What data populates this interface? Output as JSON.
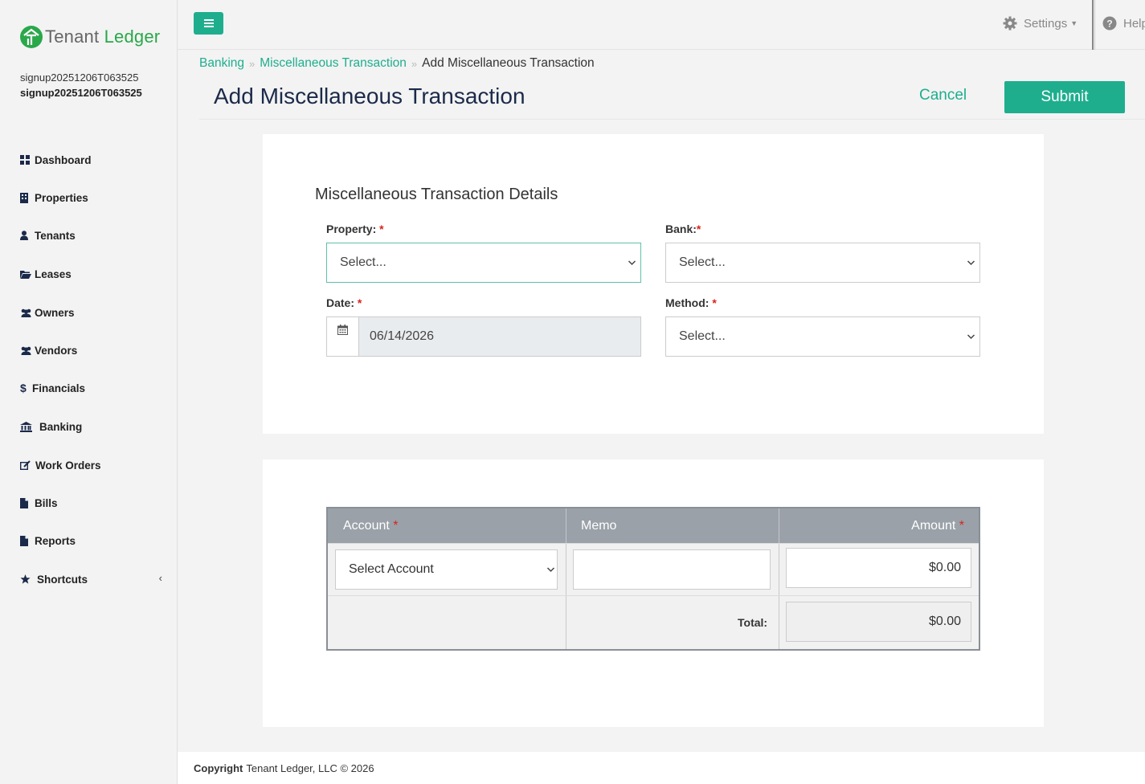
{
  "app": {
    "logo_part1": "Tenant",
    "logo_part2": "Ledger",
    "user_line1": "signup20251206T063525",
    "user_line2": "signup20251206T063525"
  },
  "sidebar": {
    "items": [
      {
        "label": "Dashboard",
        "icon": "dashboard-icon"
      },
      {
        "label": "Properties",
        "icon": "building-icon"
      },
      {
        "label": "Tenants",
        "icon": "user-icon"
      },
      {
        "label": "Leases",
        "icon": "folder-open-icon"
      },
      {
        "label": "Owners",
        "icon": "users-icon"
      },
      {
        "label": "Vendors",
        "icon": "users-icon"
      },
      {
        "label": "Financials",
        "icon": "dollar-icon"
      },
      {
        "label": "Banking",
        "icon": "bank-icon"
      },
      {
        "label": "Work Orders",
        "icon": "edit-icon"
      },
      {
        "label": "Bills",
        "icon": "file-icon"
      },
      {
        "label": "Reports",
        "icon": "file-icon"
      },
      {
        "label": "Shortcuts",
        "icon": "star-icon"
      }
    ]
  },
  "topbar": {
    "settings_label": "Settings",
    "help_label": "Help"
  },
  "breadcrumb": {
    "items": [
      "Banking",
      "Miscellaneous Transaction",
      "Add Miscellaneous Transaction"
    ]
  },
  "page": {
    "title": "Add Miscellaneous Transaction",
    "cancel_label": "Cancel",
    "submit_label": "Submit"
  },
  "details": {
    "section_title": "Miscellaneous Transaction Details",
    "property_label": "Property:",
    "property_value": "Select...",
    "bank_label": "Bank:",
    "bank_value": "Select...",
    "date_label": "Date:",
    "date_value": "06/14/2026",
    "method_label": "Method:",
    "method_value": "Select..."
  },
  "lines_table": {
    "headers": {
      "account": "Account",
      "memo": "Memo",
      "amount": "Amount"
    },
    "row": {
      "account_value": "Select Account",
      "memo_value": "",
      "amount_value": "$0.00"
    },
    "total_label": "Total:",
    "total_value": "$0.00"
  },
  "footer": {
    "copyright_label": "Copyright",
    "copyright_text": "Tenant Ledger, LLC © 2026"
  },
  "colors": {
    "accent": "#1eae8e",
    "brand_green": "#2aa84a",
    "required": "#d9241c",
    "table_header": "#9aa1a9"
  }
}
